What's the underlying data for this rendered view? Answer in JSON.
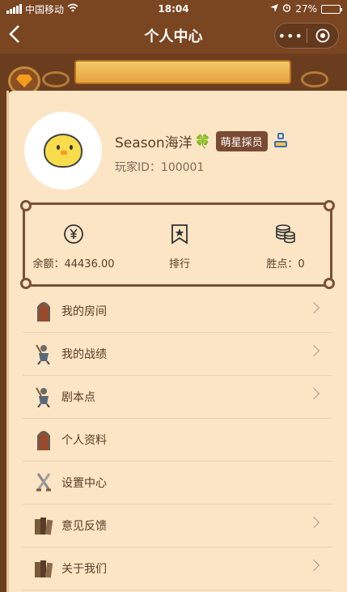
{
  "status_bar": {
    "carrier": "中国移动",
    "time": "18:04",
    "battery": "27%",
    "battery_level": 0.27
  },
  "nav": {
    "title": "个人中心",
    "back_icon": "back-arrow-icon",
    "more_label": "•••"
  },
  "profile": {
    "name": "Season海洋",
    "badge": "🍀",
    "rank": "萌星採员",
    "player_id_label": "玩家ID：",
    "player_id": "100001"
  },
  "stats": [
    {
      "icon": "yen-coin-icon",
      "label": "余额：44436.00"
    },
    {
      "icon": "bookmark-star-icon",
      "label": "排行"
    },
    {
      "icon": "coin-stack-icon",
      "label": "胜点：0"
    }
  ],
  "menu": [
    {
      "label": "我的房间",
      "icon": "door-icon",
      "chevron": true
    },
    {
      "label": "我的战绩",
      "icon": "knight-icon",
      "chevron": true
    },
    {
      "label": "剧本点",
      "icon": "knight-icon",
      "chevron": true
    },
    {
      "label": "个人资料",
      "icon": "door-icon",
      "chevron": false
    },
    {
      "label": "设置中心",
      "icon": "sword-icon",
      "chevron": false
    },
    {
      "label": "意见反馈",
      "icon": "books-icon",
      "chevron": true
    },
    {
      "label": "关于我们",
      "icon": "books-icon",
      "chevron": true
    }
  ],
  "colors": {
    "header": "#7a4521",
    "card": "#fbe5c4",
    "text": "#5a3b26",
    "accent": "#f5c021"
  }
}
